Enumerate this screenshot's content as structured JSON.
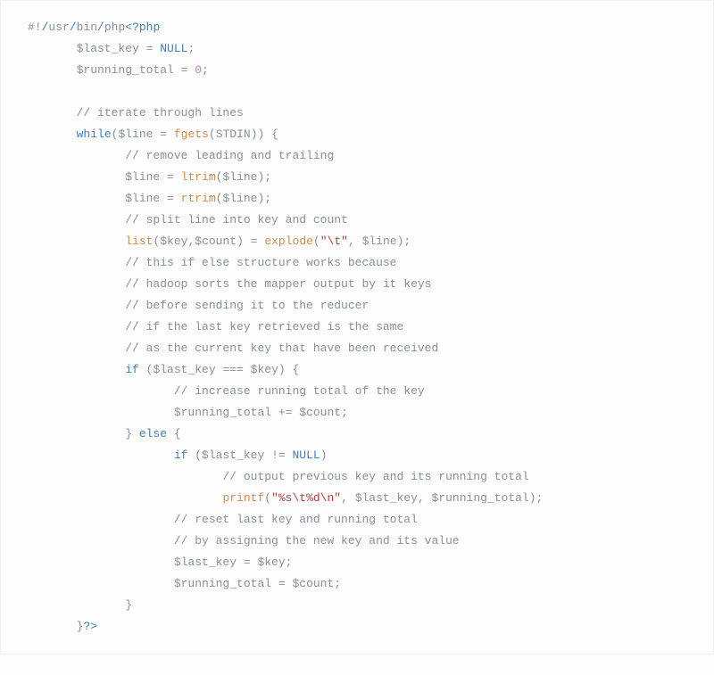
{
  "code": {
    "l1": {
      "a": "#!",
      "b": "/",
      "c": "usr",
      "d": "/",
      "e": "bin",
      "f": "/",
      "g": "php",
      "h": "<?php"
    },
    "l2": {
      "a": "$last_key",
      "b": " = ",
      "c": "NULL",
      "d": ";"
    },
    "l3": {
      "a": "$running_total",
      "b": " = ",
      "c": "0",
      "d": ";"
    },
    "l4a": "// iterate through lines",
    "l5": {
      "a": "while",
      "b": "(",
      "c": "$line",
      "d": " = ",
      "e": "fgets",
      "f": "(",
      "g": "STDIN",
      "h": ")) {"
    },
    "l6": "// remove leading and trailing",
    "l7": {
      "a": "$line",
      "b": " = ",
      "c": "ltrim",
      "d": "(",
      "e": "$line",
      "f": ");"
    },
    "l8": {
      "a": "$line",
      "b": " = ",
      "c": "rtrim",
      "d": "(",
      "e": "$line",
      "f": ");"
    },
    "l9": "// split line into key and count",
    "l10": {
      "a": "list",
      "b": "(",
      "c": "$key",
      "d": ",",
      "e": "$count",
      "f": ") = ",
      "g": "explode",
      "h": "(",
      "i": "\"\\t\"",
      "j": ", ",
      "k": "$line",
      "l": ");"
    },
    "l11": "// this if else structure works because",
    "l12": "// hadoop sorts the mapper output by it keys",
    "l13": "// before sending it to the reducer",
    "l14": "// if the last key retrieved is the same",
    "l15": "// as the current key that have been received",
    "l16": {
      "a": "if",
      "b": " (",
      "c": "$last_key",
      "d": " === ",
      "e": "$key",
      "f": ") {"
    },
    "l17": "// increase running total of the key",
    "l18": {
      "a": "$running_total",
      "b": " += ",
      "c": "$count",
      "d": ";"
    },
    "l19": {
      "a": "} ",
      "b": "else",
      "c": " {"
    },
    "l20": {
      "a": "if",
      "b": " (",
      "c": "$last_key",
      "d": " != ",
      "e": "NULL",
      "f": ")"
    },
    "l21": "// output previous key and its running total",
    "l22": {
      "a": "printf",
      "b": "(",
      "c": "\"%s\\t%d\\n\"",
      "d": ", ",
      "e": "$last_key",
      "f": ", ",
      "g": "$running_total",
      "h": ");"
    },
    "l23": "// reset last key and running total",
    "l24": "// by assigning the new key and its value",
    "l25": {
      "a": "$last_key",
      "b": " = ",
      "c": "$key",
      "d": ";"
    },
    "l26": {
      "a": "$running_total",
      "b": " = ",
      "c": "$count",
      "d": ";"
    },
    "l27": "}",
    "l28": {
      "a": "}",
      "b": "?>"
    }
  }
}
